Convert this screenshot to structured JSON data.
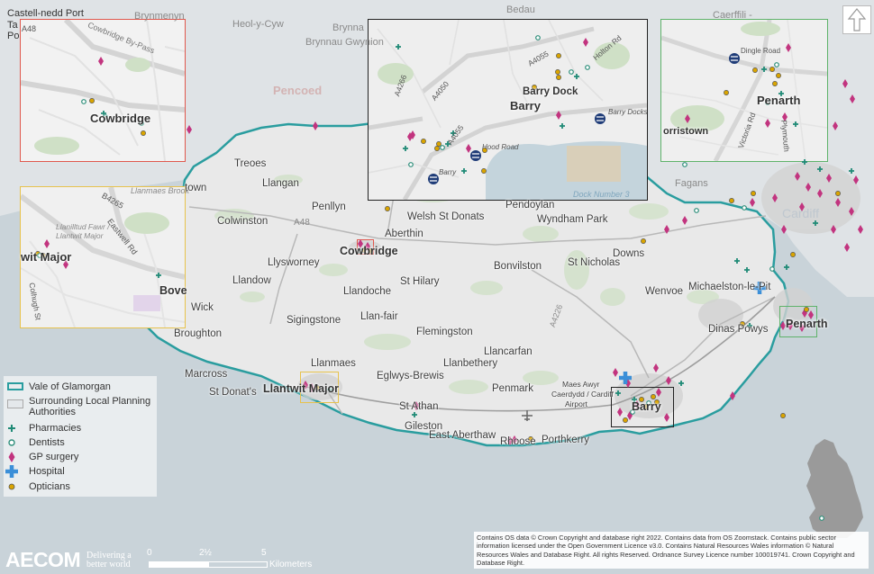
{
  "map": {
    "title": "",
    "colors": {
      "sea": "#c9d3d9",
      "land": "#e8e8e8",
      "surrounding": "#dfe3e6",
      "boundary": "#2a9d9f",
      "pharmacy": "#1f8a76",
      "dentist": "#2f8f7b",
      "gp": "#c2347f",
      "hospital": "#3b8fd8",
      "optician": "#d9a400"
    }
  },
  "places": [
    {
      "id": "llangan",
      "name": "Llangan"
    },
    {
      "id": "penllyn",
      "name": "Penllyn"
    },
    {
      "id": "colwinston",
      "name": "Colwinston"
    },
    {
      "id": "a48",
      "name": "A48"
    },
    {
      "id": "aberthin",
      "name": "Aberthin"
    },
    {
      "id": "welsh-st-donats",
      "name": "Welsh St Donats"
    },
    {
      "id": "pendoylan",
      "name": "Pendoylan"
    },
    {
      "id": "wyndham-park",
      "name": "Wyndham Park"
    },
    {
      "id": "llysworney",
      "name": "Llysworney"
    },
    {
      "id": "cowbridge",
      "name": "Cowbridge"
    },
    {
      "id": "bonvilston",
      "name": "Bonvilston"
    },
    {
      "id": "st-nicholas",
      "name": "St Nicholas"
    },
    {
      "id": "downs",
      "name": "Downs"
    },
    {
      "id": "llandow",
      "name": "Llandow"
    },
    {
      "id": "st-hilary",
      "name": "St Hilary"
    },
    {
      "id": "llandoche",
      "name": "Llandoche"
    },
    {
      "id": "wenvoe",
      "name": "Wenvoe"
    },
    {
      "id": "michaelston",
      "name": "Michaelston-le-Pit"
    },
    {
      "id": "wick",
      "name": "Wick"
    },
    {
      "id": "sigingstone",
      "name": "Sigingstone"
    },
    {
      "id": "llan-fair",
      "name": "Llan-fair"
    },
    {
      "id": "a4226",
      "name": "A4226"
    },
    {
      "id": "penarth",
      "name": "Penarth"
    },
    {
      "id": "dinas-powys",
      "name": "Dinas Powys"
    },
    {
      "id": "broughton",
      "name": "Broughton"
    },
    {
      "id": "flemingston",
      "name": "Flemingston"
    },
    {
      "id": "llancarfan",
      "name": "Llancarfan"
    },
    {
      "id": "llanbethery",
      "name": "Llanbethery"
    },
    {
      "id": "llanmaes",
      "name": "Llanmaes"
    },
    {
      "id": "marcross",
      "name": "Marcross"
    },
    {
      "id": "eglwys-brewis",
      "name": "Eglwys-Brewis"
    },
    {
      "id": "st-donats",
      "name": "St Donat's"
    },
    {
      "id": "llantwit-major",
      "name": "Llantwit Major"
    },
    {
      "id": "maes-awyr",
      "name": "Maes Awyr"
    },
    {
      "id": "caerdydd",
      "name": "Caerdydd / Cardiff"
    },
    {
      "id": "airport",
      "name": "Airport"
    },
    {
      "id": "penmark",
      "name": "Penmark"
    },
    {
      "id": "barry",
      "name": "Barry"
    },
    {
      "id": "st-athan",
      "name": "St Athan"
    },
    {
      "id": "gileston",
      "name": "Gileston"
    },
    {
      "id": "east-aberthaw",
      "name": "East Aberthaw"
    },
    {
      "id": "rhoose",
      "name": "Rhoose"
    },
    {
      "id": "porthkerry",
      "name": "Porthkerry"
    },
    {
      "id": "treoes",
      "name": "Treoes"
    },
    {
      "id": "fagans",
      "name": "Fagans"
    },
    {
      "id": "cardiff",
      "name": "Cardiff"
    },
    {
      "id": "pencoed",
      "name": "Pencoed"
    },
    {
      "id": "heol-y-cyw",
      "name": "Heol-y-Cyw"
    },
    {
      "id": "brynna",
      "name": "Brynna"
    },
    {
      "id": "brynnau",
      "name": "Brynnau Gwynion"
    },
    {
      "id": "caerffili",
      "name": "Caerffili -"
    },
    {
      "id": "bedau",
      "name": "Bedau"
    },
    {
      "id": "brynmenyn",
      "name": "Brynmenyn"
    },
    {
      "id": "castell-nedd",
      "name": "Castell-nedd Port"
    },
    {
      "id": "ta",
      "name": "Ta"
    },
    {
      "id": "po",
      "name": "Po"
    },
    {
      "id": "town-bridgend",
      "name": "town"
    }
  ],
  "insets": {
    "cowbridge": {
      "title": "Cowbridge",
      "labels": [
        "A48",
        "Cowbridge By-Pass"
      ]
    },
    "llantwit": {
      "title": "wit Major",
      "labels": [
        "Llanilltud Fawr / Llantwit Major",
        "B4265",
        "Eastwell Rd",
        "Colhugh St",
        "Bove",
        "Llanmaes Brook"
      ]
    },
    "barry": {
      "title": "Barry",
      "labels": [
        "Barry Dock",
        "A4050",
        "A4055",
        "Holton Rd",
        "A4266",
        "Hood Road",
        "Barry Docks",
        "Barry",
        "Dock Number 3",
        "A4055"
      ]
    },
    "penarth": {
      "title": "Penarth",
      "labels": [
        "Dingle Road",
        "orristown",
        "Victoria Rd",
        "Plymouth",
        "Penarth"
      ]
    }
  },
  "legend": {
    "items": [
      {
        "label": "Vale of Glamorgan",
        "symbol": "boundary"
      },
      {
        "label": "Surrounding Local Planning Authorities",
        "symbol": "area"
      },
      {
        "label": "Pharmacies",
        "symbol": "pharmacy"
      },
      {
        "label": "Dentists",
        "symbol": "dentist"
      },
      {
        "label": "GP surgery",
        "symbol": "gp"
      },
      {
        "label": "Hospital",
        "symbol": "hospital"
      },
      {
        "label": "Opticians",
        "symbol": "optician"
      }
    ]
  },
  "scale_bar": {
    "ticks": [
      "0",
      "2½",
      "5"
    ],
    "unit": "Kilometers"
  },
  "branding": {
    "logo": "AECOM",
    "tagline_1": "Delivering a",
    "tagline_2": "better world"
  },
  "credits": "Contains OS data © Crown Copyright and database right 2022. Contains data from OS Zoomstack. Contains public sector information licensed under the Open Government Licence v3.0. Contains Natural Resources Wales information © Natural Resources Wales and Database Right. All rights Reserved. Ordnance Survey Licence number 100019741. Crown Copyright and Database Right.",
  "north_arrow": {
    "icon": "north-arrow-icon"
  }
}
